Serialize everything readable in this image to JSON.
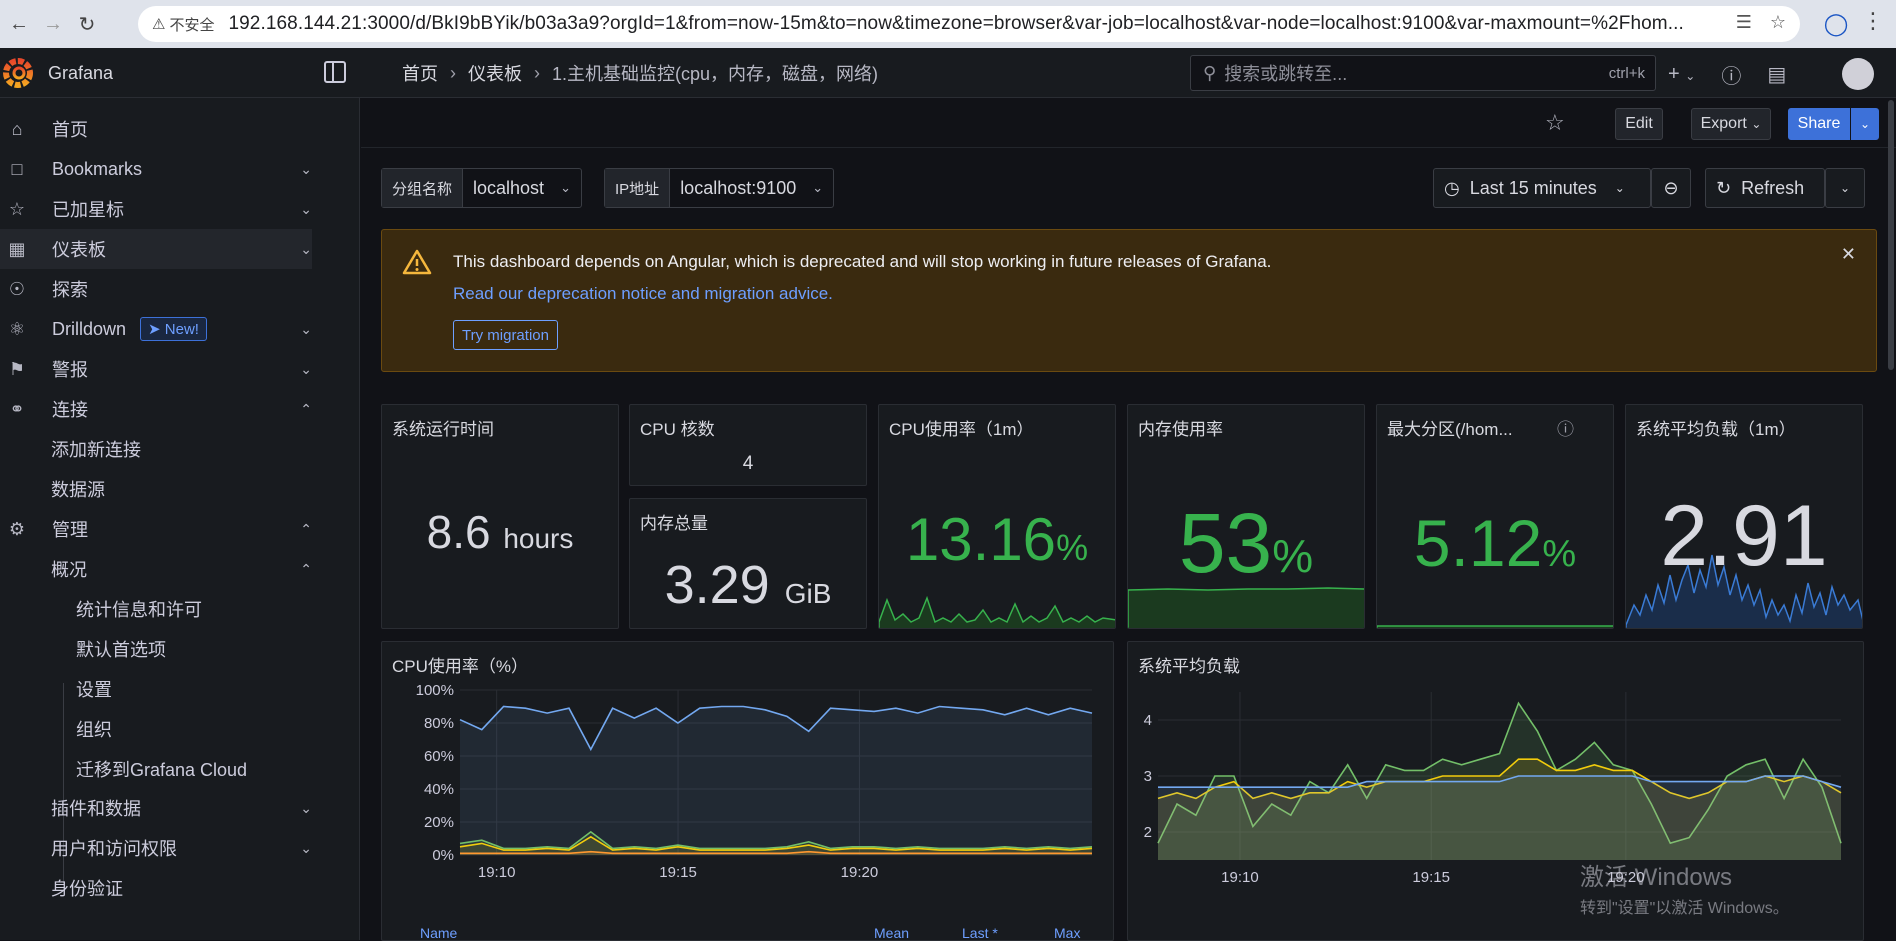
{
  "browser": {
    "insecure_label": "不安全",
    "url": "192.168.144.21:3000/d/BkI9bBYik/b03a3a9?orgId=1&from=now-15m&to=now&timezone=browser&var-job=localhost&var-node=localhost:9100&var-maxmount=%2Fhom..."
  },
  "topbar": {
    "brand": "Grafana",
    "breadcrumb": [
      "首页",
      "仪表板",
      "1.主机基础监控(cpu，内存，磁盘，网络)"
    ],
    "search_placeholder": "搜索或跳转至...",
    "search_shortcut": "ctrl+k"
  },
  "sidebar": {
    "items": [
      {
        "label": "首页",
        "icon": "home-icon"
      },
      {
        "label": "Bookmarks",
        "icon": "bookmark-icon"
      },
      {
        "label": "已加星标",
        "icon": "star-icon"
      },
      {
        "label": "仪表板",
        "icon": "apps-icon"
      },
      {
        "label": "探索",
        "icon": "compass-icon"
      },
      {
        "label": "Drilldown",
        "icon": "drilldown-icon",
        "badge": "New!"
      },
      {
        "label": "警报",
        "icon": "bell-icon"
      },
      {
        "label": "连接",
        "icon": "link-icon"
      },
      {
        "label": "管理",
        "icon": "cog-icon"
      }
    ],
    "sub_connections": [
      "添加新连接",
      "数据源"
    ],
    "sub_admin": {
      "label": "概况",
      "children": [
        "统计信息和许可",
        "默认首选项",
        "设置",
        "组织",
        "迁移到Grafana Cloud"
      ]
    },
    "sub_admin_rest": [
      "插件和数据",
      "用户和访问权限",
      "身份验证"
    ]
  },
  "toolbar": {
    "edit": "Edit",
    "export": "Export",
    "share": "Share"
  },
  "variables": [
    {
      "label": "分组名称",
      "value": "localhost"
    },
    {
      "label": "IP地址",
      "value": "localhost:9100"
    }
  ],
  "time": {
    "range": "Last 15 minutes",
    "refresh": "Refresh"
  },
  "alert": {
    "title": "This dashboard depends on Angular, which is deprecated and will stop working in future releases of Grafana.",
    "link": "Read our deprecation notice and migration advice.",
    "button": "Try migration"
  },
  "panels": {
    "uptime": {
      "title": "系统运行时间",
      "value": "8.6",
      "unit": "hours"
    },
    "cpu_cores": {
      "title": "CPU 核数",
      "value": "4"
    },
    "mem_total": {
      "title": "内存总量",
      "value": "3.29",
      "unit": "GiB"
    },
    "cpu_usage": {
      "title": "CPU使用率（1m）",
      "value": "13.16",
      "unit": "%"
    },
    "mem_usage": {
      "title": "内存使用率",
      "value": "53",
      "unit": "%"
    },
    "max_partition": {
      "title": "最大分区(/hom...",
      "value": "5.12",
      "unit": "%"
    },
    "load_avg": {
      "title": "系统平均负载（1m）",
      "value": "2.91"
    },
    "cpu_chart_title": "CPU使用率（%）",
    "load_chart_title": "系统平均负载",
    "legend_headers": [
      "Name",
      "Mean",
      "Last *",
      "Max"
    ]
  },
  "colors": {
    "green": "#37b24d",
    "blue": "#73a8f0",
    "yellow": "#f2cc0c",
    "orange": "#ff9830",
    "lightgreen": "#73bf69",
    "accent": "#3d71d9"
  },
  "watermark": {
    "line1": "激活 Windows",
    "line2": "转到\"设置\"以激活 Windows。"
  },
  "chart_data": [
    {
      "type": "line",
      "title": "CPU使用率（%）",
      "x": [
        "19:10",
        "19:15",
        "19:20"
      ],
      "ylim": [
        0,
        100
      ],
      "yticks": [
        "0%",
        "20%",
        "40%",
        "60%",
        "80%",
        "100%"
      ],
      "series": [
        {
          "values": [
            82,
            76,
            90,
            89,
            86,
            89,
            64,
            89,
            83,
            89,
            80,
            89,
            90,
            90,
            88,
            84,
            75,
            89,
            88,
            87,
            89,
            86,
            90,
            89,
            88,
            85,
            89,
            85,
            89,
            86
          ]
        },
        {
          "values": [
            7,
            9,
            4,
            4,
            5,
            4,
            14,
            4,
            5,
            4,
            6,
            4,
            4,
            4,
            4,
            5,
            8,
            4,
            5,
            5,
            4,
            5,
            4,
            4,
            4,
            5,
            4,
            5,
            4,
            5
          ]
        },
        {
          "values": [
            5,
            7,
            3,
            3,
            4,
            3,
            11,
            3,
            4,
            3,
            5,
            3,
            3,
            3,
            3,
            4,
            6,
            3,
            4,
            4,
            3,
            4,
            3,
            3,
            3,
            4,
            3,
            4,
            3,
            4
          ]
        },
        {
          "values": [
            1,
            1,
            1,
            1,
            1,
            1,
            2,
            1,
            1,
            1,
            1,
            1,
            1,
            1,
            1,
            1,
            2,
            1,
            1,
            1,
            1,
            1,
            1,
            1,
            1,
            1,
            1,
            1,
            1,
            1
          ]
        }
      ]
    },
    {
      "type": "line",
      "title": "系统平均负载",
      "x": [
        "19:10",
        "19:15",
        "19:20"
      ],
      "ylim": [
        1.5,
        4.5
      ],
      "yticks": [
        "2",
        "3",
        "4"
      ],
      "series": [
        {
          "values": [
            1.8,
            2.5,
            2.3,
            3.0,
            3.0,
            2.1,
            2.5,
            2.3,
            2.9,
            2.7,
            3.2,
            2.6,
            3.2,
            3.1,
            3.1,
            3.3,
            3.2,
            3.3,
            3.4,
            4.3,
            3.8,
            3.1,
            3.3,
            3.6,
            3.2,
            3.1,
            2.5,
            1.8,
            1.9,
            2.4,
            3.0,
            3.2,
            3.3,
            2.6,
            3.3,
            2.8,
            1.8
          ]
        },
        {
          "values": [
            2.6,
            2.7,
            2.6,
            2.8,
            2.9,
            2.6,
            2.7,
            2.6,
            2.7,
            2.7,
            2.9,
            2.8,
            2.9,
            2.9,
            2.9,
            3.0,
            3.0,
            3.0,
            3.0,
            3.3,
            3.3,
            3.1,
            3.1,
            3.2,
            3.1,
            3.1,
            2.9,
            2.7,
            2.6,
            2.7,
            2.9,
            2.9,
            3.0,
            2.9,
            3.0,
            2.9,
            2.7
          ]
        },
        {
          "values": [
            2.8,
            2.8,
            2.8,
            2.8,
            2.8,
            2.8,
            2.8,
            2.8,
            2.8,
            2.8,
            2.8,
            2.9,
            2.9,
            2.9,
            2.9,
            2.9,
            2.9,
            2.9,
            2.9,
            3.0,
            3.0,
            3.0,
            3.0,
            3.0,
            3.0,
            3.0,
            2.9,
            2.9,
            2.9,
            2.9,
            2.9,
            2.9,
            3.0,
            3.0,
            3.0,
            2.9,
            2.8
          ]
        }
      ]
    }
  ]
}
